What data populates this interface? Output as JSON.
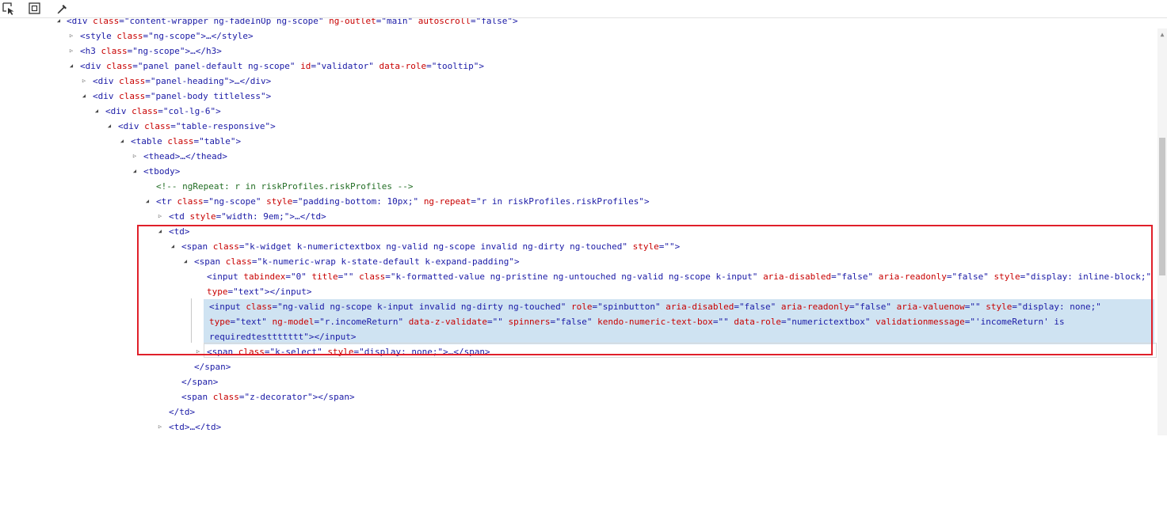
{
  "toolbar": {
    "icons": [
      "inspect-pointer-icon",
      "box-model-icon",
      "color-picker-icon"
    ],
    "glyphs": [
      "⬉",
      "▢",
      "✎"
    ]
  },
  "tree": [
    {
      "tri": "◢",
      "segments": [
        [
          "t",
          "<div "
        ],
        [
          "a",
          "class"
        ],
        [
          "t",
          "="
        ],
        [
          "v",
          "\"content-wrapper ng-fadeInOp ng-scope\""
        ],
        [
          "t",
          " "
        ],
        [
          "a",
          "ng-outlet"
        ],
        [
          "t",
          "="
        ],
        [
          "v",
          "\"main\""
        ],
        [
          "t",
          " "
        ],
        [
          "a",
          "autoscroll"
        ],
        [
          "t",
          "="
        ],
        [
          "v",
          "\"false\""
        ],
        [
          "t",
          ">"
        ]
      ]
    },
    {
      "tri": "▷",
      "segments": [
        [
          "t",
          "<style "
        ],
        [
          "a",
          "class"
        ],
        [
          "t",
          "="
        ],
        [
          "v",
          "\"ng-scope\""
        ],
        [
          "t",
          ">…</style>"
        ]
      ]
    },
    {
      "tri": "▷",
      "segments": [
        [
          "t",
          "<h3 "
        ],
        [
          "a",
          "class"
        ],
        [
          "t",
          "="
        ],
        [
          "v",
          "\"ng-scope\""
        ],
        [
          "t",
          ">…</h3>"
        ]
      ]
    },
    {
      "tri": "◢",
      "segments": [
        [
          "t",
          "<div "
        ],
        [
          "a",
          "class"
        ],
        [
          "t",
          "="
        ],
        [
          "v",
          "\"panel panel-default ng-scope\""
        ],
        [
          "t",
          " "
        ],
        [
          "a",
          "id"
        ],
        [
          "t",
          "="
        ],
        [
          "v",
          "\"validator\""
        ],
        [
          "t",
          " "
        ],
        [
          "a",
          "data-role"
        ],
        [
          "t",
          "="
        ],
        [
          "v",
          "\"tooltip\""
        ],
        [
          "t",
          ">"
        ]
      ]
    },
    {
      "tri": "▷",
      "segments": [
        [
          "t",
          "<div "
        ],
        [
          "a",
          "class"
        ],
        [
          "t",
          "="
        ],
        [
          "v",
          "\"panel-heading\""
        ],
        [
          "t",
          ">…</div>"
        ]
      ]
    },
    {
      "tri": "◢",
      "segments": [
        [
          "t",
          "<div "
        ],
        [
          "a",
          "class"
        ],
        [
          "t",
          "="
        ],
        [
          "v",
          "\"panel-body titleless\""
        ],
        [
          "t",
          ">"
        ]
      ]
    },
    {
      "tri": "◢",
      "segments": [
        [
          "t",
          "<div "
        ],
        [
          "a",
          "class"
        ],
        [
          "t",
          "="
        ],
        [
          "v",
          "\"col-lg-6\""
        ],
        [
          "t",
          ">"
        ]
      ]
    },
    {
      "tri": "◢",
      "segments": [
        [
          "t",
          "<div "
        ],
        [
          "a",
          "class"
        ],
        [
          "t",
          "="
        ],
        [
          "v",
          "\"table-responsive\""
        ],
        [
          "t",
          ">"
        ]
      ]
    },
    {
      "tri": "◢",
      "segments": [
        [
          "t",
          "<table "
        ],
        [
          "a",
          "class"
        ],
        [
          "t",
          "="
        ],
        [
          "v",
          "\"table\""
        ],
        [
          "t",
          ">"
        ]
      ]
    },
    {
      "tri": "▷",
      "segments": [
        [
          "t",
          "<thead>…</thead>"
        ]
      ]
    },
    {
      "tri": "◢",
      "segments": [
        [
          "t",
          "<tbody>"
        ]
      ]
    },
    {
      "tri": "",
      "segments": [
        [
          "c",
          "<!-- ngRepeat: r in riskProfiles.riskProfiles -->"
        ]
      ]
    },
    {
      "tri": "◢",
      "segments": [
        [
          "t",
          "<tr "
        ],
        [
          "a",
          "class"
        ],
        [
          "t",
          "="
        ],
        [
          "v",
          "\"ng-scope\""
        ],
        [
          "t",
          " "
        ],
        [
          "a",
          "style"
        ],
        [
          "t",
          "="
        ],
        [
          "v",
          "\"padding-bottom: 10px;\""
        ],
        [
          "t",
          " "
        ],
        [
          "a",
          "ng-repeat"
        ],
        [
          "t",
          "="
        ],
        [
          "v",
          "\"r in riskProfiles.riskProfiles\""
        ],
        [
          "t",
          ">"
        ]
      ]
    },
    {
      "tri": "▷",
      "segments": [
        [
          "t",
          "<td "
        ],
        [
          "a",
          "style"
        ],
        [
          "t",
          "="
        ],
        [
          "v",
          "\"width: 9em;\""
        ],
        [
          "t",
          ">…</td>"
        ]
      ]
    },
    {
      "tri": "◢",
      "segments": [
        [
          "t",
          "<td>"
        ]
      ]
    },
    {
      "tri": "◢",
      "segments": [
        [
          "t",
          "<span "
        ],
        [
          "a",
          "class"
        ],
        [
          "t",
          "="
        ],
        [
          "v",
          "\"k-widget k-numerictextbox ng-valid ng-scope invalid ng-dirty ng-touched\""
        ],
        [
          "t",
          " "
        ],
        [
          "a",
          "style"
        ],
        [
          "t",
          "="
        ],
        [
          "v",
          "\"\""
        ],
        [
          "t",
          ">"
        ]
      ]
    },
    {
      "tri": "◢",
      "segments": [
        [
          "t",
          "<span "
        ],
        [
          "a",
          "class"
        ],
        [
          "t",
          "="
        ],
        [
          "v",
          "\"k-numeric-wrap k-state-default k-expand-padding\""
        ],
        [
          "t",
          ">"
        ]
      ]
    },
    {
      "tri": "",
      "segments": [
        [
          "t",
          "<input "
        ],
        [
          "a",
          "tabindex"
        ],
        [
          "t",
          "="
        ],
        [
          "v",
          "\"0\""
        ],
        [
          "t",
          " "
        ],
        [
          "a",
          "title"
        ],
        [
          "t",
          "="
        ],
        [
          "v",
          "\"\""
        ],
        [
          "t",
          " "
        ],
        [
          "a",
          "class"
        ],
        [
          "t",
          "="
        ],
        [
          "v",
          "\"k-formatted-value ng-pristine ng-untouched ng-valid ng-scope k-input\""
        ],
        [
          "t",
          " "
        ],
        [
          "a",
          "aria-disabled"
        ],
        [
          "t",
          "="
        ],
        [
          "v",
          "\"false\""
        ],
        [
          "t",
          " "
        ],
        [
          "a",
          "aria-readonly"
        ],
        [
          "t",
          "="
        ],
        [
          "v",
          "\"false\""
        ],
        [
          "t",
          " "
        ],
        [
          "a",
          "style"
        ],
        [
          "t",
          "="
        ],
        [
          "v",
          "\"display: inline-block;\""
        ]
      ]
    },
    {
      "tri": "",
      "segments": [
        [
          "a",
          "type"
        ],
        [
          "t",
          "="
        ],
        [
          "v",
          "\"text\""
        ],
        [
          "t",
          "></input>"
        ]
      ]
    },
    {
      "tri": "",
      "sel": true,
      "segments": [
        [
          "t",
          "<input "
        ],
        [
          "a",
          "class"
        ],
        [
          "t",
          "="
        ],
        [
          "v",
          "\"ng-valid ng-scope k-input invalid ng-dirty ng-touched\""
        ],
        [
          "t",
          " "
        ],
        [
          "a",
          "role"
        ],
        [
          "t",
          "="
        ],
        [
          "v",
          "\"spinbutton\""
        ],
        [
          "t",
          " "
        ],
        [
          "a",
          "aria-disabled"
        ],
        [
          "t",
          "="
        ],
        [
          "v",
          "\"false\""
        ],
        [
          "t",
          " "
        ],
        [
          "a",
          "aria-readonly"
        ],
        [
          "t",
          "="
        ],
        [
          "v",
          "\"false\""
        ],
        [
          "t",
          " "
        ],
        [
          "a",
          "aria-valuenow"
        ],
        [
          "t",
          "="
        ],
        [
          "v",
          "\"\""
        ],
        [
          "t",
          " "
        ],
        [
          "a",
          "style"
        ],
        [
          "t",
          "="
        ],
        [
          "v",
          "\"display: none;\""
        ]
      ]
    },
    {
      "tri": "",
      "sel": true,
      "segments": [
        [
          "a",
          "type"
        ],
        [
          "t",
          "="
        ],
        [
          "v",
          "\"text\""
        ],
        [
          "t",
          " "
        ],
        [
          "a",
          "ng-model"
        ],
        [
          "t",
          "="
        ],
        [
          "v",
          "\"r.incomeReturn\""
        ],
        [
          "t",
          " "
        ],
        [
          "a",
          "data-z-validate"
        ],
        [
          "t",
          "="
        ],
        [
          "v",
          "\"\""
        ],
        [
          "t",
          " "
        ],
        [
          "a",
          "spinners"
        ],
        [
          "t",
          "="
        ],
        [
          "v",
          "\"false\""
        ],
        [
          "t",
          " "
        ],
        [
          "a",
          "kendo-numeric-text-box"
        ],
        [
          "t",
          "="
        ],
        [
          "v",
          "\"\""
        ],
        [
          "t",
          " "
        ],
        [
          "a",
          "data-role"
        ],
        [
          "t",
          "="
        ],
        [
          "v",
          "\"numerictextbox\""
        ],
        [
          "t",
          " "
        ],
        [
          "a",
          "validationmessage"
        ],
        [
          "t",
          "="
        ],
        [
          "v",
          "\"'incomeReturn' is"
        ]
      ]
    },
    {
      "tri": "",
      "sel": true,
      "segments": [
        [
          "v",
          "requiredtesttttttt\""
        ],
        [
          "t",
          "></input>"
        ]
      ]
    },
    {
      "tri": "▷",
      "segments": [
        [
          "t",
          "<span "
        ],
        [
          "a",
          "class"
        ],
        [
          "t",
          "="
        ],
        [
          "v",
          "\"k-select\""
        ],
        [
          "t",
          " "
        ],
        [
          "a",
          "style"
        ],
        [
          "t",
          "="
        ],
        [
          "v",
          "\"display: none;\""
        ],
        [
          "t",
          ">…</span>"
        ]
      ]
    },
    {
      "tri": "",
      "segments": [
        [
          "t",
          "</span>"
        ]
      ]
    },
    {
      "tri": "",
      "segments": [
        [
          "t",
          "</span>"
        ]
      ]
    },
    {
      "tri": "",
      "segments": [
        [
          "t",
          "<span "
        ],
        [
          "a",
          "class"
        ],
        [
          "t",
          "="
        ],
        [
          "v",
          "\"z-decorator\""
        ],
        [
          "t",
          "></span>"
        ]
      ]
    },
    {
      "tri": "",
      "segments": [
        [
          "t",
          "</td>"
        ]
      ]
    },
    {
      "tri": "▷",
      "segments": [
        [
          "t",
          "<td>…</td>"
        ]
      ]
    }
  ],
  "scrollbar": {
    "up_arrow": "▲"
  }
}
